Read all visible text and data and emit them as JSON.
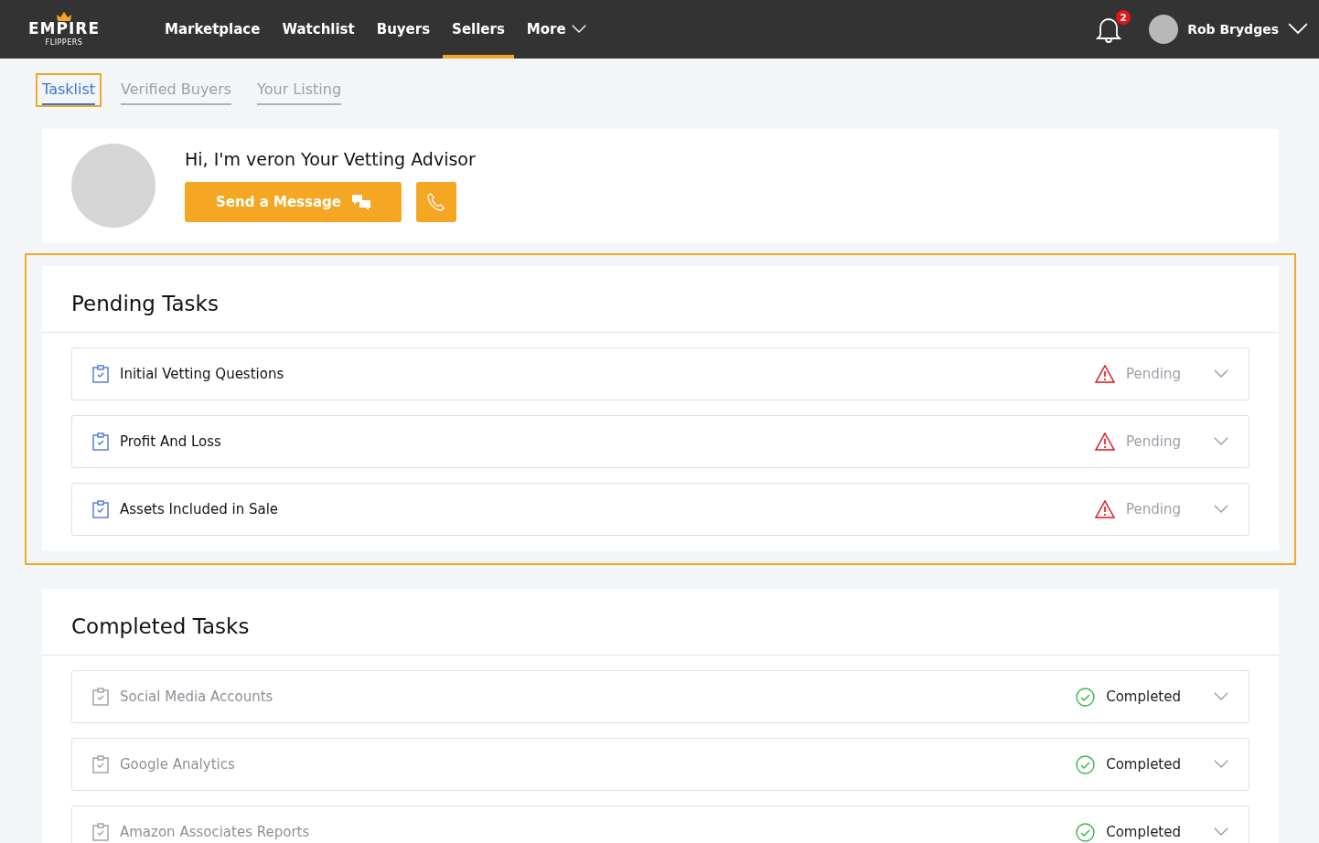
{
  "header": {
    "logo": {
      "word": "EMPIRE",
      "subword": "FLIPPERS"
    },
    "nav": [
      {
        "label": "Marketplace",
        "selected": false,
        "dropdown": false
      },
      {
        "label": "Watchlist",
        "selected": false,
        "dropdown": false
      },
      {
        "label": "Buyers",
        "selected": false,
        "dropdown": false
      },
      {
        "label": "Sellers",
        "selected": true,
        "dropdown": false
      },
      {
        "label": "More",
        "selected": false,
        "dropdown": true
      }
    ],
    "notifications": "2",
    "user": "Rob Brydges"
  },
  "tabs": [
    {
      "label": "Tasklist",
      "selected": true,
      "highlighted": true
    },
    {
      "label": "Verified Buyers",
      "selected": false,
      "highlighted": false
    },
    {
      "label": "Your Listing",
      "selected": false,
      "highlighted": false
    }
  ],
  "advisor": {
    "greeting": "Hi, I'm veron Your Vetting Advisor",
    "message_button": "Send a Message"
  },
  "sections": [
    {
      "title": "Pending Tasks",
      "highlighted": true,
      "tasks": [
        {
          "name": "Initial Vetting Questions",
          "status": "Pending",
          "kind": "pending"
        },
        {
          "name": "Profit And Loss",
          "status": "Pending",
          "kind": "pending"
        },
        {
          "name": "Assets Included in Sale",
          "status": "Pending",
          "kind": "pending"
        }
      ]
    },
    {
      "title": "Completed Tasks",
      "highlighted": false,
      "tasks": [
        {
          "name": "Social Media Accounts",
          "status": "Completed",
          "kind": "completed"
        },
        {
          "name": "Google Analytics",
          "status": "Completed",
          "kind": "completed"
        },
        {
          "name": "Amazon Associates Reports",
          "status": "Completed",
          "kind": "completed"
        }
      ]
    }
  ]
}
